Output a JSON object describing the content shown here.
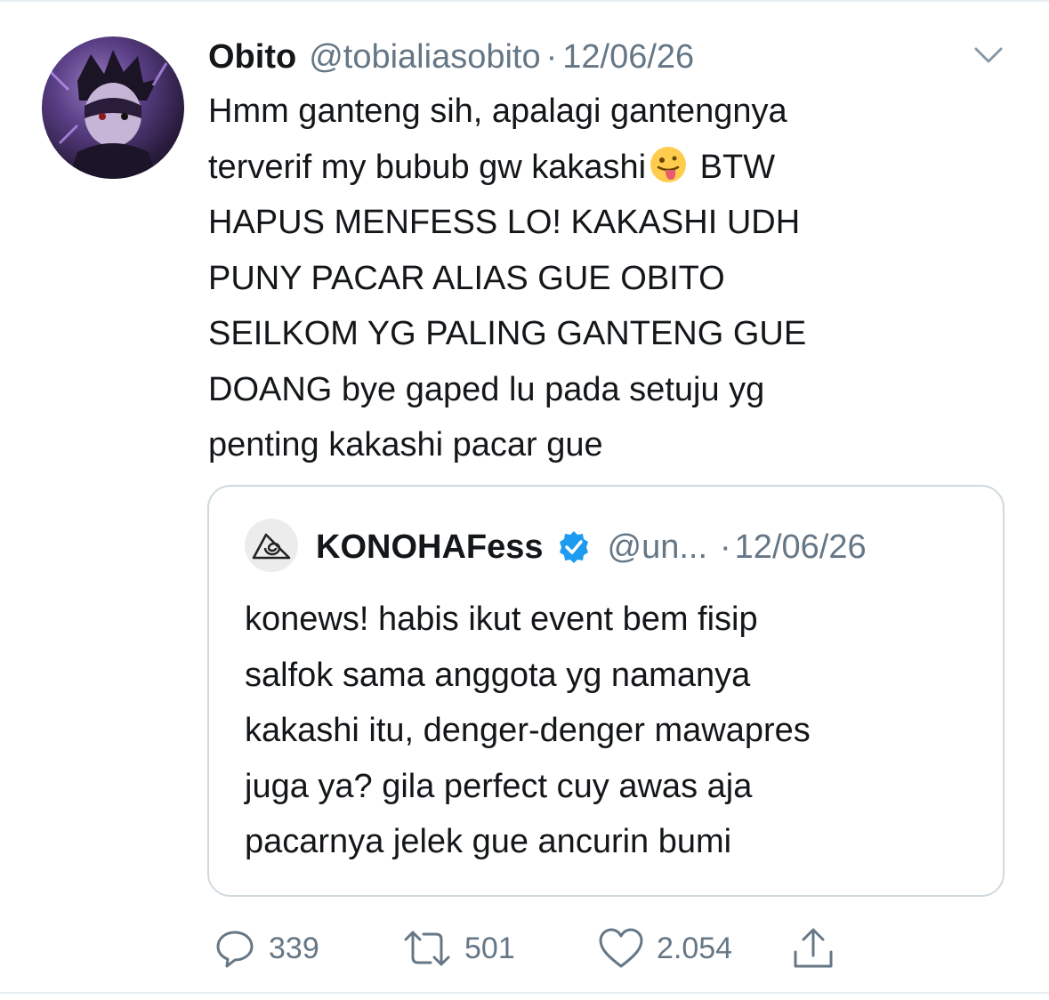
{
  "tweet": {
    "author_name": "Obito",
    "author_handle": "@tobialiasobito",
    "separator": "·",
    "date": "12/06/26",
    "text_lines": [
      "Hmm ganteng sih, apalagi gantengnya",
      "terverif my bubub gw kakashi",
      "BTW",
      "HAPUS MENFESS LO! KAKASHI UDH",
      "PUNY PACAR ALIAS GUE OBITO",
      "SEILKOM YG PALING GANTENG GUE",
      "DOANG bye gaped lu pada setuju yg",
      "penting kakashi pacar gue"
    ],
    "emoji": "tongue-out-face-emoji"
  },
  "quoted_tweet": {
    "author_name": "KONOHAFess",
    "verified": true,
    "author_handle": "@un...",
    "separator": "·",
    "date": "12/06/26",
    "text_lines": [
      "konews! habis ikut event bem fisip",
      "salfok sama anggota yg namanya",
      "kakashi itu, denger-denger mawapres",
      "juga ya? gila perfect cuy awas aja",
      "pacarnya jelek gue ancurin bumi"
    ]
  },
  "actions": {
    "reply_count": "339",
    "retweet_count": "501",
    "like_count": "2.054"
  },
  "colors": {
    "text": "#14171a",
    "secondary": "#657786",
    "border": "#cfd9de",
    "verified": "#1d9bf0"
  },
  "icons": [
    "chevron-down-icon",
    "verified-badge-icon",
    "reply-icon",
    "retweet-icon",
    "like-icon",
    "share-icon",
    "leaf-symbol-icon"
  ]
}
